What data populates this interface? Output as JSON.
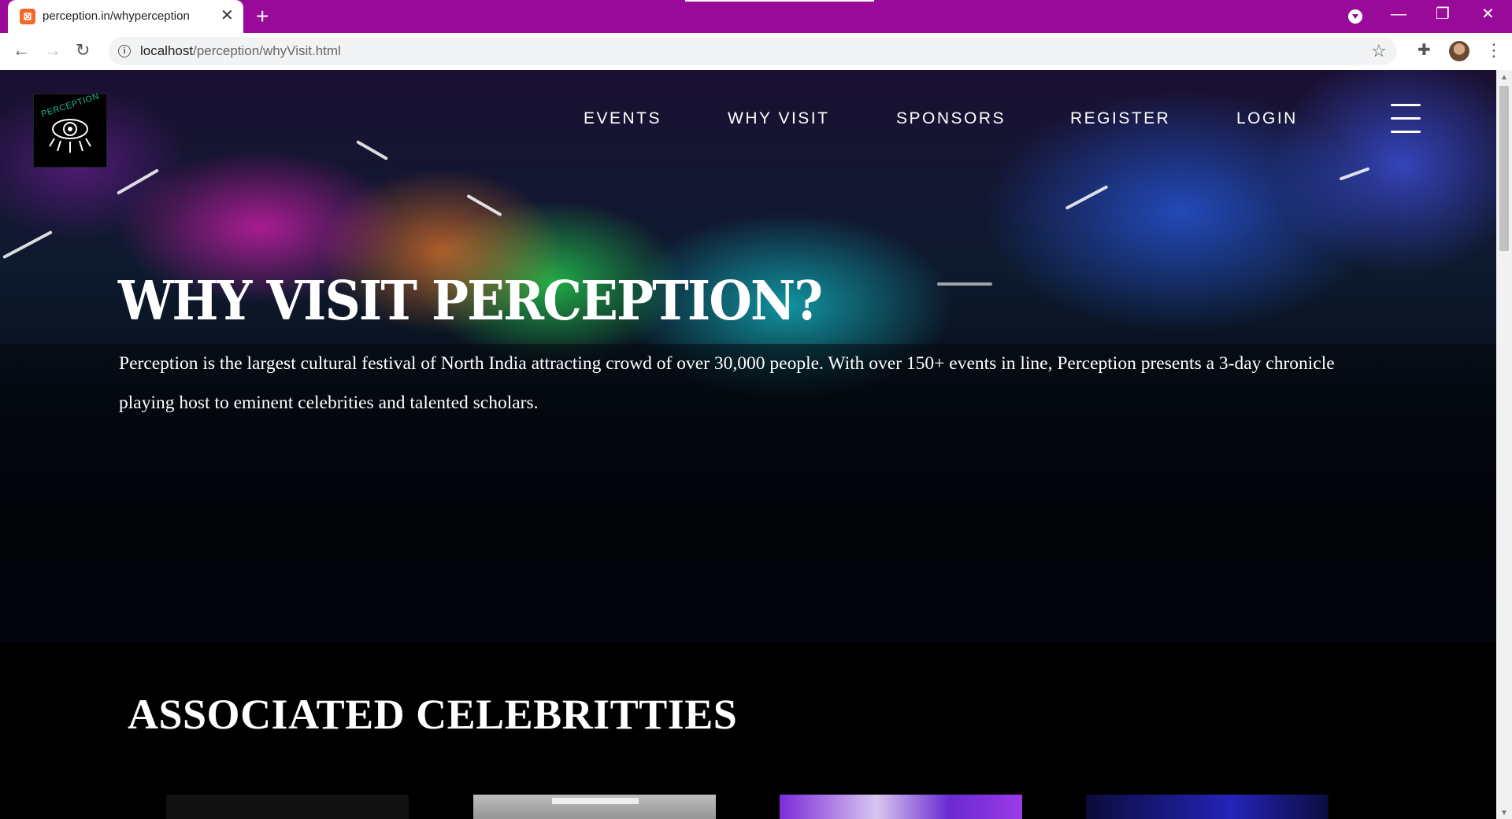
{
  "browser": {
    "tab_title": "perception.in/whyperception",
    "tab_close": "✕",
    "new_tab": "+",
    "url_host": "localhost",
    "url_path": "/perception/whyVisit.html",
    "back": "←",
    "forward": "→",
    "reload": "↻",
    "minimize": "—",
    "restore": "❐",
    "close": "✕",
    "star": "☆",
    "extensions": "✚",
    "menu": "⋮"
  },
  "site": {
    "logo_text": "PERCEPTION",
    "nav": [
      {
        "label": "EVENTS"
      },
      {
        "label": "WHY VISIT"
      },
      {
        "label": "SPONSORS"
      },
      {
        "label": "REGISTER"
      },
      {
        "label": "LOGIN"
      }
    ],
    "hero": {
      "title": "WHY VISIT PERCEPTION?",
      "description": "Perception is the largest cultural festival of North India attracting crowd of over 30,000 people. With over 150+ events in line, Perception presents a 3-day chronicle playing host to eminent celebrities and talented scholars."
    },
    "celebrities": {
      "heading": "ASSOCIATED CELEBRITTIES"
    }
  },
  "colors": {
    "tabbar": "#9a0a98",
    "logo_accent": "#1fb59a"
  }
}
